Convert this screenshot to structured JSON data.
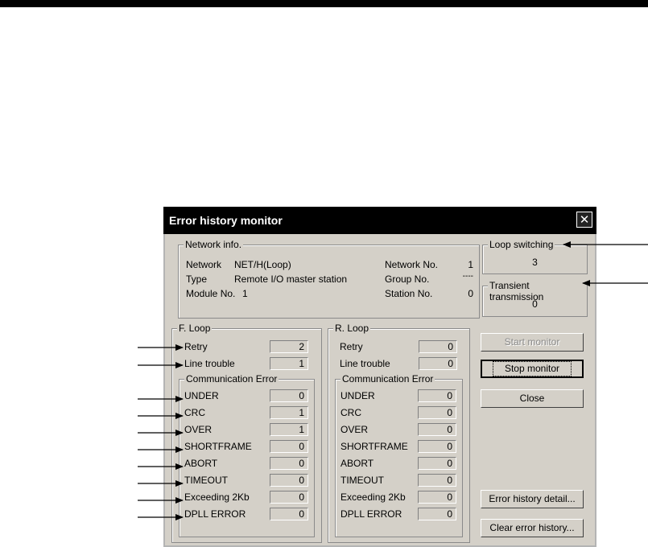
{
  "window": {
    "title": "Error history monitor"
  },
  "network_info": {
    "title": "Network info.",
    "network_label": "Network",
    "network_value": "NET/H(Loop)",
    "type_label": "Type",
    "type_value": "Remote I/O master station",
    "module_label": "Module No.",
    "module_value": "1",
    "network_no_label": "Network No.",
    "network_no_value": "1",
    "group_no_label": "Group No.",
    "group_no_value": "----",
    "station_no_label": "Station No.",
    "station_no_value": "0"
  },
  "loop_switching": {
    "title": "Loop switching",
    "value": "3"
  },
  "transient": {
    "title": "Transient transmission",
    "value": "0"
  },
  "f_loop": {
    "title": "F. Loop",
    "retry_label": "Retry",
    "retry_value": "2",
    "line_trouble_label": "Line trouble",
    "line_trouble_value": "1",
    "comm_title": "Communication Error",
    "errors": [
      {
        "label": "UNDER",
        "value": "0"
      },
      {
        "label": "CRC",
        "value": "1"
      },
      {
        "label": "OVER",
        "value": "1"
      },
      {
        "label": "SHORTFRAME",
        "value": "0"
      },
      {
        "label": "ABORT",
        "value": "0"
      },
      {
        "label": "TIMEOUT",
        "value": "0"
      },
      {
        "label": "Exceeding 2Kb",
        "value": "0"
      },
      {
        "label": "DPLL ERROR",
        "value": "0"
      }
    ]
  },
  "r_loop": {
    "title": "R. Loop",
    "retry_label": "Retry",
    "retry_value": "0",
    "line_trouble_label": "Line trouble",
    "line_trouble_value": "0",
    "comm_title": "Communication Error",
    "errors": [
      {
        "label": "UNDER",
        "value": "0"
      },
      {
        "label": "CRC",
        "value": "0"
      },
      {
        "label": "OVER",
        "value": "0"
      },
      {
        "label": "SHORTFRAME",
        "value": "0"
      },
      {
        "label": "ABORT",
        "value": "0"
      },
      {
        "label": "TIMEOUT",
        "value": "0"
      },
      {
        "label": "Exceeding 2Kb",
        "value": "0"
      },
      {
        "label": "DPLL ERROR",
        "value": "0"
      }
    ]
  },
  "buttons": {
    "start_monitor": "Start monitor",
    "stop_monitor": "Stop monitor",
    "close": "Close",
    "error_history_detail": "Error history detail...",
    "clear_error_history": "Clear error history..."
  }
}
